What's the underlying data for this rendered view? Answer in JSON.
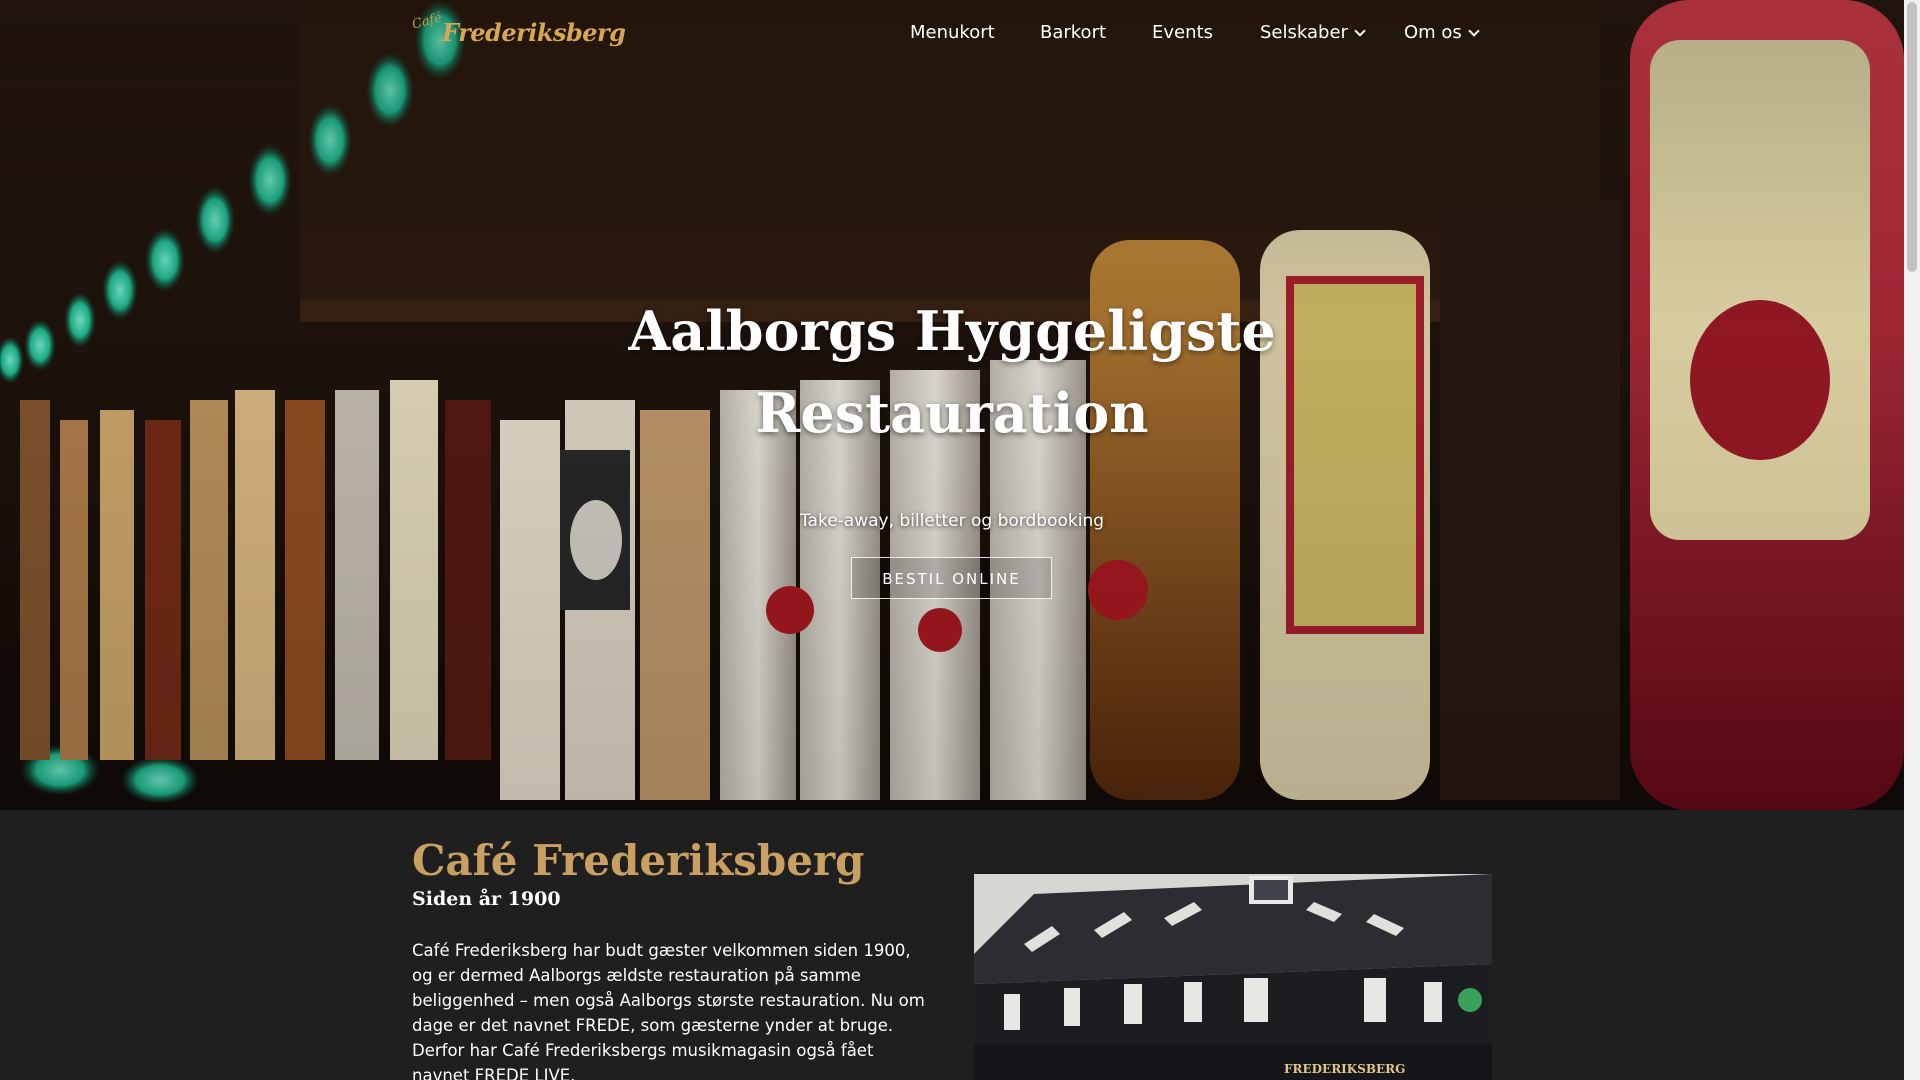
{
  "header": {
    "logo_text_small": "Café",
    "logo_text": "Frederiksberg",
    "nav": [
      {
        "label": "Menukort",
        "has_dropdown": false
      },
      {
        "label": "Barkort",
        "has_dropdown": false
      },
      {
        "label": "Events",
        "has_dropdown": false
      },
      {
        "label": "Selskaber",
        "has_dropdown": true
      },
      {
        "label": "Om os",
        "has_dropdown": true
      }
    ]
  },
  "hero": {
    "title_line1": "Aalborgs Hyggeligste",
    "title_line2": "Restauration",
    "subtitle": "Take-away, billetter og bordbooking",
    "cta_label": "BESTIL ONLINE"
  },
  "about": {
    "title": "Café Frederiksberg",
    "subtitle": "Siden år 1900",
    "body": "Café Frederiksberg har budt gæster velkommen siden 1900, og er dermed Aalborgs ældste restauration på samme beliggenhed – men også Aalborgs største restauration. Nu om dage er det navnet FREDE, som gæsterne ynder at bruge. Derfor har Café Frederiksbergs musikmagasin også fået navnet FREDE LIVE.",
    "building_sign": "FREDERIKSBERG"
  },
  "colors": {
    "accent_gold": "#c9a062",
    "background": "#1f1f1f",
    "text": "#ffffff"
  },
  "icons": {
    "dropdown": "chevron-down-icon"
  }
}
